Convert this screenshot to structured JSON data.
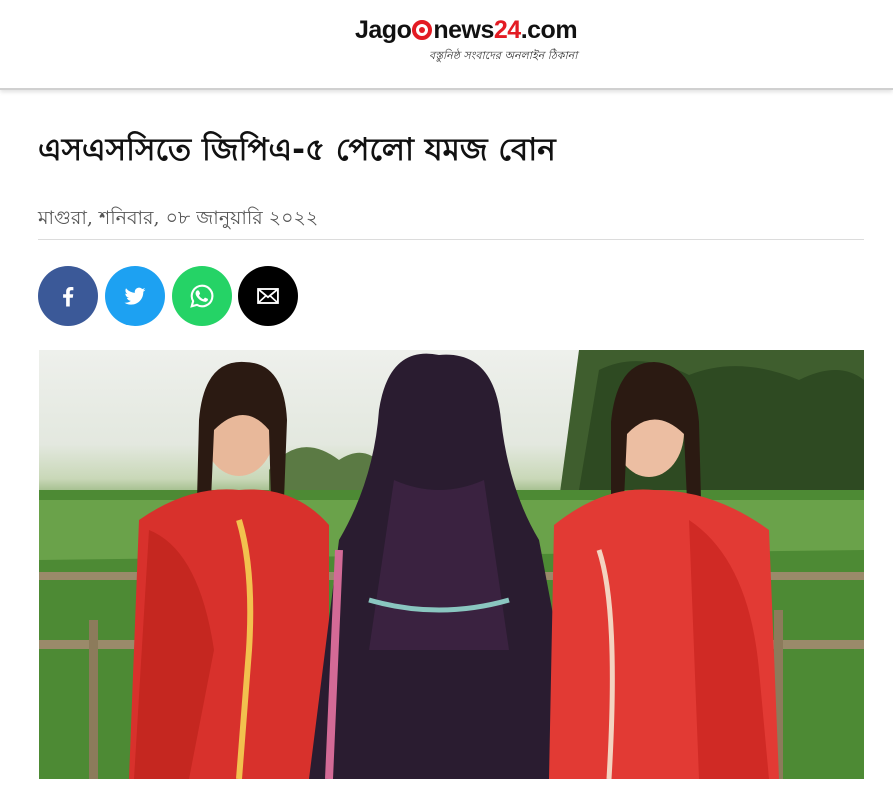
{
  "site": {
    "logo_jago": "Jago",
    "logo_news": "news",
    "logo_number": "24",
    "logo_domain": ".com",
    "tagline": "বস্তুনিষ্ঠ সংবাদের অনলাইন ঠিকানা",
    "brand_color": "#e31b23"
  },
  "article": {
    "headline": "এসএসসিতে জিপিএ-৫ পেলো যমজ বোন",
    "dateline": "মাগুরা, শনিবার, ০৮ জানুয়ারি ২০২২"
  },
  "share": {
    "buttons": [
      {
        "icon": "facebook-icon",
        "color": "#3b5998"
      },
      {
        "icon": "twitter-icon",
        "color": "#1da1f2"
      },
      {
        "icon": "whatsapp-icon",
        "color": "#25d366"
      },
      {
        "icon": "email-icon",
        "color": "#000000"
      }
    ]
  },
  "photo": {
    "subject": "twin-sisters-with-mother-photo"
  }
}
